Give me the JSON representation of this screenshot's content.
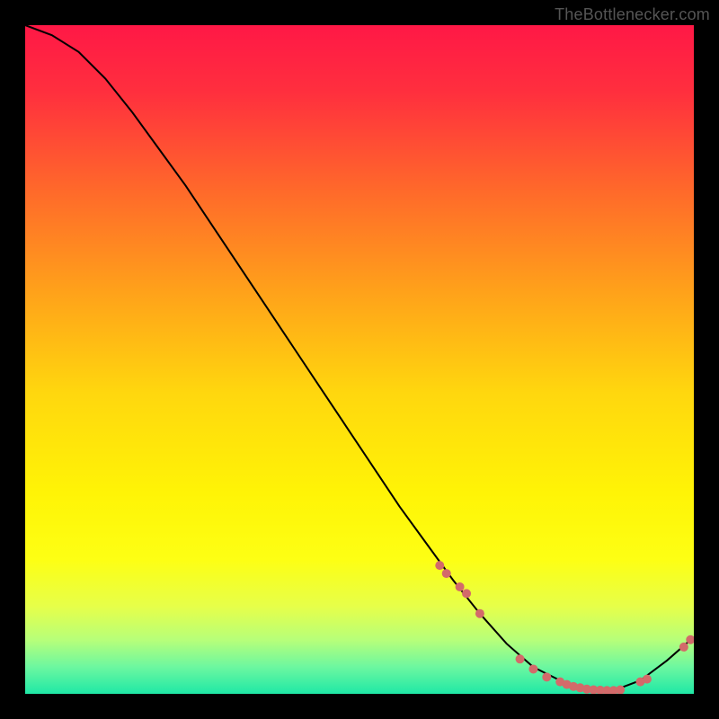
{
  "credit": "TheBottlenecker.com",
  "chart_data": {
    "type": "line",
    "title": "",
    "xlabel": "",
    "ylabel": "",
    "xlim": [
      0,
      100
    ],
    "ylim": [
      0,
      100
    ],
    "background": {
      "style": "vertical-gradient",
      "stops": [
        {
          "pos": 0.0,
          "color": "#ff1846"
        },
        {
          "pos": 0.1,
          "color": "#ff2f3e"
        },
        {
          "pos": 0.25,
          "color": "#ff6a2a"
        },
        {
          "pos": 0.4,
          "color": "#ffa21a"
        },
        {
          "pos": 0.55,
          "color": "#ffd70e"
        },
        {
          "pos": 0.7,
          "color": "#fff406"
        },
        {
          "pos": 0.8,
          "color": "#fdff14"
        },
        {
          "pos": 0.87,
          "color": "#e6ff4a"
        },
        {
          "pos": 0.92,
          "color": "#b6ff7a"
        },
        {
          "pos": 0.96,
          "color": "#6cf7a0"
        },
        {
          "pos": 1.0,
          "color": "#1fe8a6"
        }
      ]
    },
    "series": [
      {
        "name": "bottleneck-curve",
        "stroke": "#000000",
        "stroke_width": 2,
        "x": [
          0,
          4,
          8,
          12,
          16,
          20,
          24,
          28,
          32,
          36,
          40,
          44,
          48,
          52,
          56,
          60,
          64,
          68,
          72,
          76,
          80,
          84,
          88,
          92,
          96,
          100
        ],
        "y": [
          100,
          98.5,
          96,
          92,
          87,
          81.5,
          76,
          70,
          64,
          58,
          52,
          46,
          40,
          34,
          28,
          22.5,
          17,
          12,
          7.5,
          4,
          2,
          0.5,
          0.5,
          2,
          5,
          8.5
        ]
      }
    ],
    "markers": {
      "name": "sample-points",
      "color": "#d36a6a",
      "radius_px": 5,
      "x": [
        62,
        63,
        65,
        66,
        68,
        74,
        76,
        78,
        80,
        81,
        82,
        83,
        84,
        85,
        86,
        87,
        88,
        89,
        92,
        93,
        98.5,
        99.5
      ],
      "y": [
        19.2,
        18,
        16,
        15,
        12,
        5.2,
        3.7,
        2.5,
        1.8,
        1.4,
        1.1,
        0.9,
        0.7,
        0.6,
        0.55,
        0.5,
        0.5,
        0.6,
        1.8,
        2.2,
        7.0,
        8.1
      ]
    }
  }
}
